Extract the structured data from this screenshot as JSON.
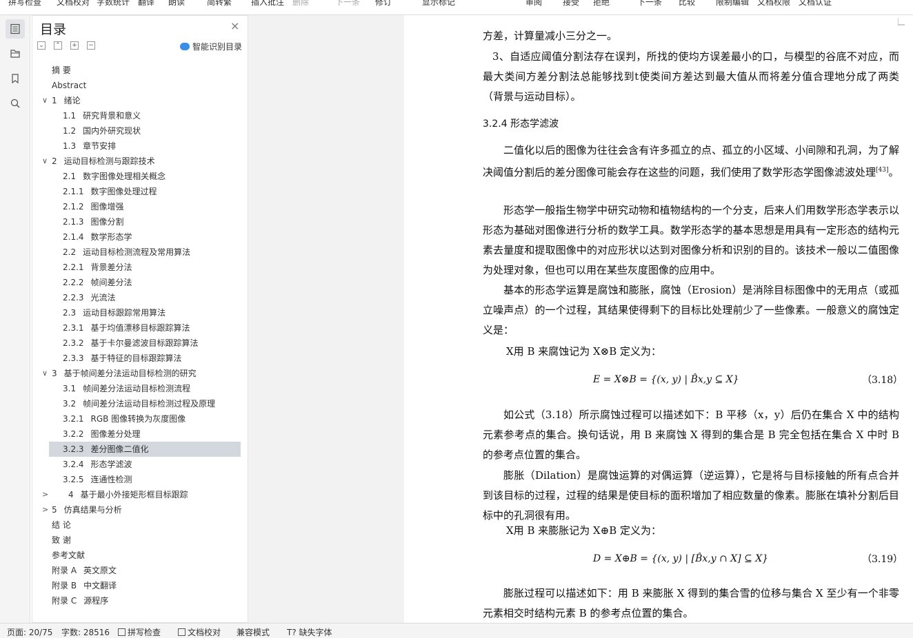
{
  "toolbar": {
    "spellcheck": "拼写检查",
    "doccheck": "文档校对",
    "wordcount": "字数统计",
    "translate": "翻译",
    "read": "朗读",
    "convert": "简转繁",
    "insert_comment": "插入批注",
    "delete": "删除",
    "next": "下一条",
    "revise": "修订",
    "show_markup": "显示标记",
    "review": "审阅",
    "accept": "接受",
    "reject": "拒绝",
    "next2": "下一条",
    "compare": "比较",
    "restrict": "限制编辑",
    "permission": "文档权限",
    "certify": "文档认证"
  },
  "toc": {
    "title": "目录",
    "close": "×",
    "smart_label": "智能识别目录",
    "items": [
      {
        "num": "",
        "text": "摘  要",
        "indent": 0
      },
      {
        "num": "",
        "text": "Abstract",
        "indent": 0
      },
      {
        "num": "1",
        "text": "绪论",
        "indent": 0,
        "chev": "∨"
      },
      {
        "num": "1.1",
        "text": "研究背景和意义",
        "indent": 1
      },
      {
        "num": "1.2",
        "text": "国内外研究现状",
        "indent": 1
      },
      {
        "num": "1.3",
        "text": "章节安排",
        "indent": 1
      },
      {
        "num": "2",
        "text": "运动目标检测与跟踪技术",
        "indent": 0,
        "chev": "∨"
      },
      {
        "num": "2.1",
        "text": "数字图像处理相关概念",
        "indent": 1
      },
      {
        "num": "2.1.1",
        "text": "数字图像处理过程",
        "indent": 1
      },
      {
        "num": "2.1.2",
        "text": "图像增强",
        "indent": 1
      },
      {
        "num": "2.1.3",
        "text": "图像分割",
        "indent": 1
      },
      {
        "num": "2.1.4",
        "text": "数学形态学",
        "indent": 1
      },
      {
        "num": "2.2",
        "text": "运动目标检测流程及常用算法",
        "indent": 1
      },
      {
        "num": "2.2.1",
        "text": "背景差分法",
        "indent": 1
      },
      {
        "num": "2.2.2",
        "text": "帧间差分法",
        "indent": 1
      },
      {
        "num": "2.2.3",
        "text": "光流法",
        "indent": 1
      },
      {
        "num": "2.3",
        "text": "运动目标跟踪常用算法",
        "indent": 1
      },
      {
        "num": "2.3.1",
        "text": "基于均值漂移目标跟踪算法",
        "indent": 1
      },
      {
        "num": "2.3.2",
        "text": "基于卡尔曼滤波目标跟踪算法",
        "indent": 1
      },
      {
        "num": "2.3.3",
        "text": "基于特征的目标跟踪算法",
        "indent": 1
      },
      {
        "num": "3",
        "text": "基于帧间差分法运动目标检测的研究",
        "indent": 0,
        "chev": "∨"
      },
      {
        "num": "3.1",
        "text": "帧间差分法运动目标检测流程",
        "indent": 1
      },
      {
        "num": "3.2",
        "text": "帧间差分法运动目标检测过程及原理",
        "indent": 1
      },
      {
        "num": "3.2.1",
        "text": "RGB 图像转换为灰度图像",
        "indent": 1
      },
      {
        "num": "3.2.2",
        "text": "图像差分处理",
        "indent": 1
      },
      {
        "num": "3.2.3",
        "text": "差分图像二值化",
        "indent": 1,
        "selected": true
      },
      {
        "num": "3.2.4",
        "text": "形态学滤波",
        "indent": 1
      },
      {
        "num": "3.2.5",
        "text": "连通性检测",
        "indent": 1
      },
      {
        "num": "4",
        "text": "基于最小外接矩形框目标跟踪",
        "indent": 2,
        "chev": ">"
      },
      {
        "num": "5",
        "text": "仿真结果与分析",
        "indent": 0,
        "chev": ">"
      },
      {
        "num": "",
        "text": "结  论",
        "indent": 0
      },
      {
        "num": "",
        "text": "致  谢",
        "indent": 0
      },
      {
        "num": "",
        "text": "参考文献",
        "indent": 0
      },
      {
        "num": "附录 A",
        "text": "英文原文",
        "indent": 0
      },
      {
        "num": "附录 B",
        "text": "中文翻译",
        "indent": 0
      },
      {
        "num": "附录 C",
        "text": "源程序",
        "indent": 0
      }
    ]
  },
  "doc": {
    "p0": "方差，计算量减小三分之一。",
    "p1": "3、自适应阈值分割法存在误判，所找的使均方误差最小的口，与模型的谷底不对应，而最大类间方差分割法总能够找到t使类间方差达到最大值从而将差分值合理地分成了两类（背景与运动目标）。",
    "heading": "3.2.4   形态学滤波",
    "p2": "二值化以后的图像为往往会含有许多孤立的点、孤立的小区域、小间隙和孔洞，为了解决阈值分割后的差分图像可能会存在这些的问题，我们使用了数学形态学图像滤波处理",
    "p2_ref": "[43]",
    "p2_end": "。",
    "p3": "形态学一般指生物学中研究动物和植物结构的一个分支，后来人们用数学形态学表示以形态为基础对图像进行分析的数学工具。数学形态学的基本思想是用具有一定形态的结构元素去量度和提取图像中的对应形状以达到对图像分析和识别的目的。该技术一般以二值图像为处理对象，但也可以用在某些灰度图像的应用中。",
    "p4": "基本的形态学运算是腐蚀和膨胀，腐蚀（Erosion）是消除目标图像中的无用点（或孤立噪声点）的一个过程，其结果使得剩下的目标比处理前少了一些像素。一般意义的腐蚀定义是：",
    "p5": "X用 B 来腐蚀记为 X⊗B 定义为：",
    "eq1": "E = X⊗B = {(x, y) | B̂x,y ⊆ X}",
    "eq1_num": "（3.18）",
    "p6": "如公式（3.18）所示腐蚀过程可以描述如下：B 平移（x，y）后仍在集合 X 中的结构元素参考点的集合。换句话说，用 B 来腐蚀 X 得到的集合是 B 完全包括在集合 X 中时 B 的参考点位置的集合。",
    "p7": "膨胀（Dilation）是腐蚀运算的对偶运算（逆运算），它是将与目标接触的所有点合并到该目标的过程，过程的结果是使目标的面积增加了相应数量的像素。膨胀在填补分割后目标中的孔洞很有用。",
    "p8": "X用 B 来膨胀记为 X⊕B 定义为：",
    "eq2": "D = X⊕B = {(x, y) | [B̂x,y ∩ X] ⊆ X}",
    "eq2_num": "（3.19）",
    "p9": "膨胀过程可以描述如下：用 B 来膨胀 X 得到的集合雪的位移与集合 X 至少有一个非零元素相交时结构元素 B 的参考点位置的集合。"
  },
  "status": {
    "page": "页面: 20/75",
    "words": "字数: 28516",
    "spell": "拼写检查",
    "proof": "文档校对",
    "compat": "兼容模式",
    "missing_font": "缺失字体"
  }
}
